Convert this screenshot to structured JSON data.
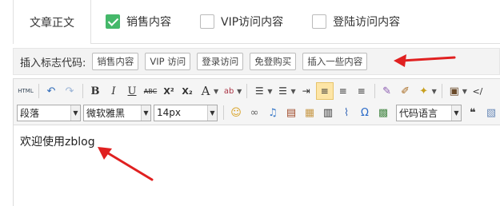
{
  "tabs": [
    {
      "label": "文章正文",
      "active": true
    },
    {
      "label": "销售内容",
      "checked": true
    },
    {
      "label": "VIP访问内容",
      "checked": false
    },
    {
      "label": "登陆访问内容",
      "checked": false
    }
  ],
  "insert_row": {
    "label": "插入标志代码:",
    "buttons": [
      "销售内容",
      "VIP 访问",
      "登录访问",
      "免登购买",
      "插入一些内容"
    ]
  },
  "toolbar": {
    "row1_icons": [
      "html-icon",
      "undo-icon",
      "redo-icon",
      "bold-icon",
      "italic-icon",
      "underline-icon",
      "strikethrough-icon",
      "superscript-icon",
      "subscript-icon",
      "font-color-icon",
      "highlight-icon",
      "ordered-list-icon",
      "unordered-list-icon",
      "indent-icon",
      "align-left-icon",
      "align-center-icon",
      "align-right-icon",
      "eraser-icon",
      "format-brush-icon",
      "magic-icon",
      "paste-icon",
      "source-code-icon"
    ],
    "glyphs": {
      "html": "HTML",
      "bold": "B",
      "italic": "I",
      "underline": "U",
      "strike": "ABC",
      "sup": "X²",
      "sub": "X₂",
      "font_color": "A",
      "highlight": "ab",
      "quote": "❝"
    },
    "selects": {
      "paragraph": "段落",
      "font": "微软雅黑",
      "size": "14px",
      "code": "代码语言"
    },
    "accent_active": "#fde5a6"
  },
  "editor": {
    "content": "欢迎使用zblog"
  },
  "colors": {
    "checkbox_checked": "#45b86a",
    "arrow": "#e02020"
  }
}
